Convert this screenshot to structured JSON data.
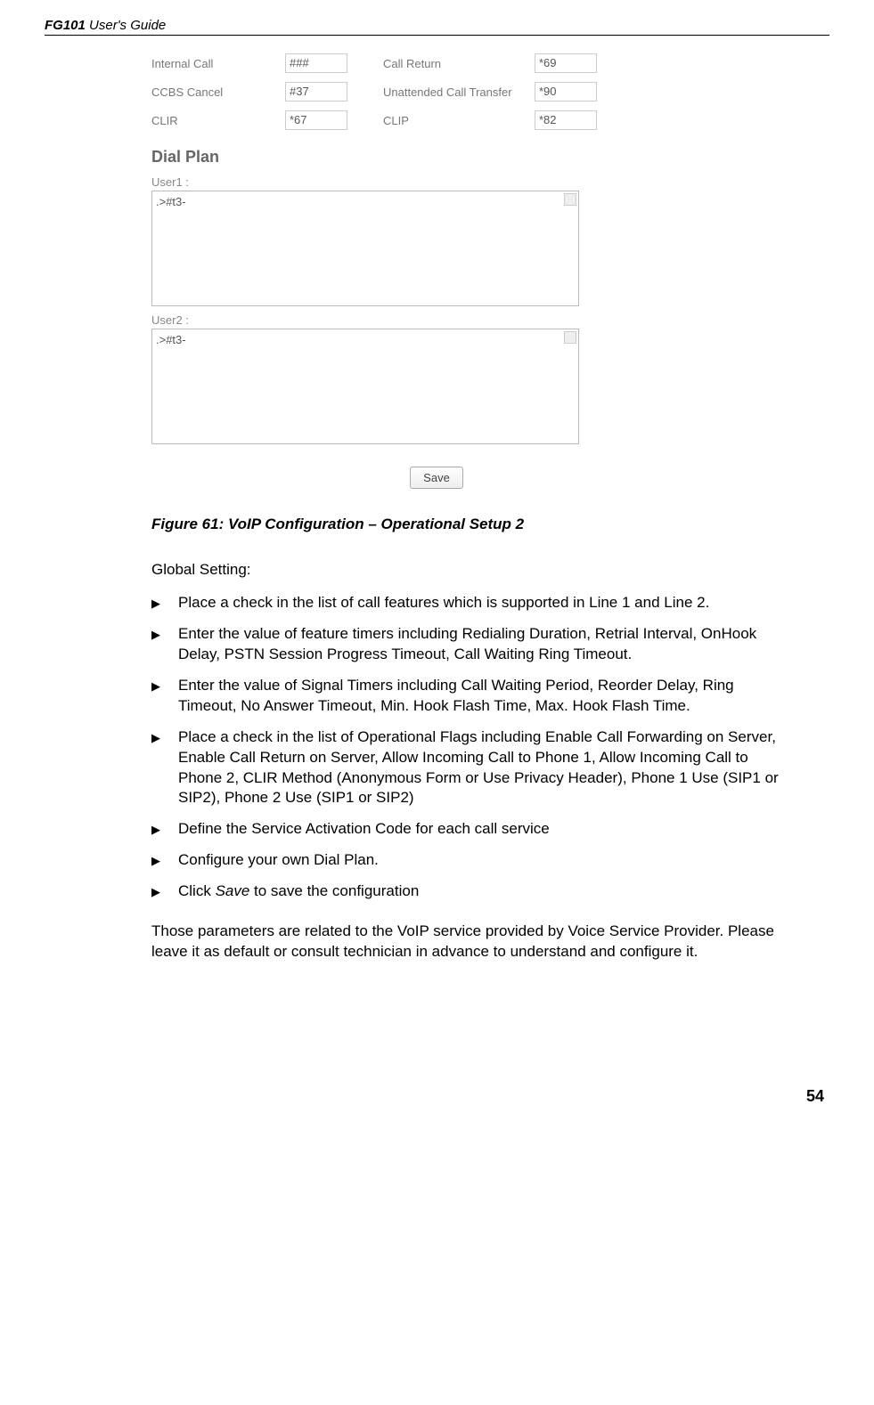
{
  "header": {
    "bold": "FG101",
    "rest": " User's Guide"
  },
  "screenshot": {
    "rows": [
      {
        "l1": "Internal Call",
        "v1": "###",
        "l2": "Call Return",
        "v2": "*69"
      },
      {
        "l1": "CCBS Cancel",
        "v1": "#37",
        "l2": "Unattended Call Transfer",
        "v2": "*90"
      },
      {
        "l1": "CLIR",
        "v1": "*67",
        "l2": "CLIP",
        "v2": "*82"
      }
    ],
    "dialPlanHeading": "Dial Plan",
    "user1Label": "User1 :",
    "user1Value": ".>#t3-",
    "user2Label": "User2 :",
    "user2Value": ".>#t3-",
    "saveLabel": "Save"
  },
  "figureCaption": "Figure 61: VoIP Configuration – Operational Setup 2",
  "intro": "Global Setting:",
  "bullets": [
    "Place a check in the list of call features which is supported in Line 1 and Line 2.",
    "Enter the value of feature timers including Redialing Duration, Retrial Interval, OnHook Delay, PSTN Session Progress Timeout, Call Waiting Ring Timeout.",
    "Enter the value of Signal Timers including Call Waiting Period, Reorder Delay, Ring Timeout, No Answer Timeout, Min. Hook Flash Time, Max. Hook Flash Time.",
    "Place a check in the list of Operational Flags including Enable Call Forwarding on Server, Enable Call Return on Server, Allow Incoming Call to Phone 1, Allow Incoming Call to Phone 2, CLIR Method (Anonymous Form or Use Privacy Header), Phone 1 Use (SIP1 or SIP2), Phone 2 Use (SIP1 or SIP2)",
    "Define the Service Activation Code for each call service",
    "Configure your own Dial Plan.",
    "Click Save to save the configuration"
  ],
  "bulletSaveIndex": 6,
  "notes": "Those parameters are related to the VoIP service provided by Voice Service Provider. Please leave it as default or consult technician in advance to understand and configure it.",
  "pageNumber": "54"
}
